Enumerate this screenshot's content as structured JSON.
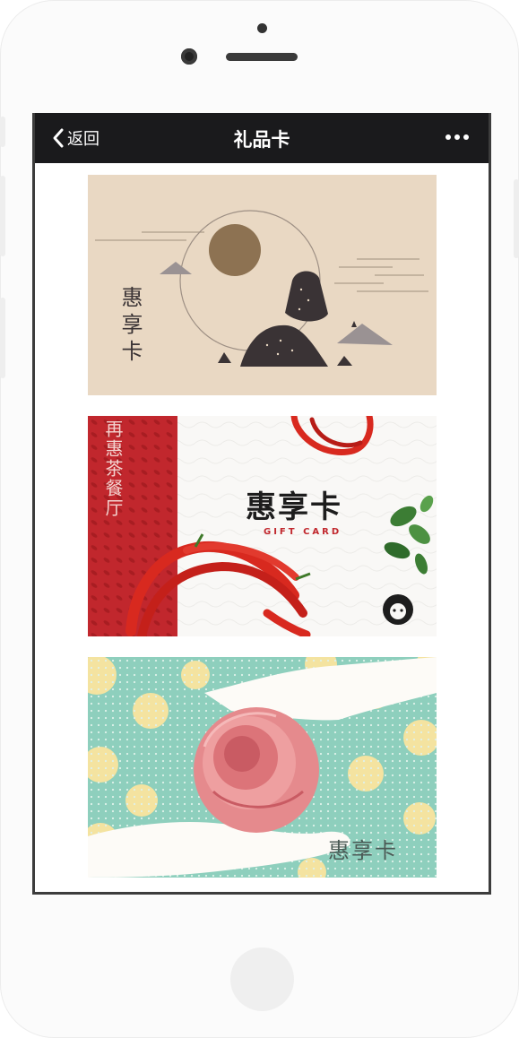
{
  "nav": {
    "back_label": "返回",
    "title": "礼品卡"
  },
  "cards": [
    {
      "title": "惠享卡",
      "colors": {
        "background": "#e9d8c3",
        "sun": "#8d7252",
        "mountain": "#3a3335",
        "accent": "#9a9293"
      }
    },
    {
      "title": "惠享卡",
      "subtitle": "GIFT CARD",
      "side_text": "再惠茶餐厅",
      "colors": {
        "band": "#c1272d",
        "pepper": "#d8291f",
        "text": "#1d1d1d",
        "gift_text": "#c1272d"
      }
    },
    {
      "title": "惠享卡",
      "colors": {
        "background": "#8ecfbd",
        "dot": "#f4e3a0",
        "rose": "#e58a8d",
        "hand": "#fdfbf7"
      }
    }
  ]
}
